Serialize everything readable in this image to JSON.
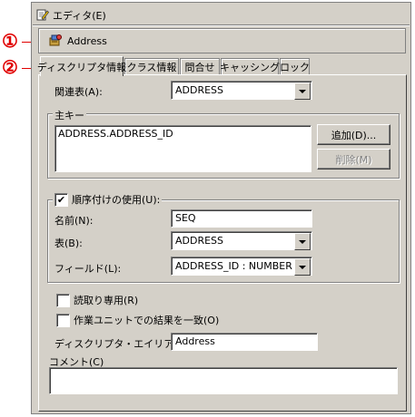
{
  "callouts": {
    "one": "①",
    "two": "②"
  },
  "editor": {
    "title": "エディタ(E)",
    "header_name": "Address",
    "icon": "pencil-edit-icon",
    "header_icon": "class-descriptor-icon"
  },
  "tabs": [
    {
      "label": "ディスクリプタ情報",
      "active": true
    },
    {
      "label": "クラス情報"
    },
    {
      "label": "問合せ"
    },
    {
      "label": "キャッシング"
    },
    {
      "label": "ロック"
    }
  ],
  "form": {
    "related_table_label": "関連表(A):",
    "related_table_value": "ADDRESS",
    "primary_key": {
      "group_label": "主キー",
      "items": [
        "ADDRESS.ADDRESS_ID"
      ],
      "add_button": "追加(D)...",
      "remove_button": "削除(M)"
    },
    "sequencing": {
      "checkbox_label": "順序付けの使用(U):",
      "checked": true,
      "name_label": "名前(N):",
      "name_value": "SEQ",
      "table_label": "表(B):",
      "table_value": "ADDRESS",
      "field_label": "フィールド(L):",
      "field_value": "ADDRESS_ID : NUMBER"
    },
    "read_only_label": "読取り専用(R)",
    "read_only_checked": false,
    "unit_of_work_label": "作業ユニットでの結果を一致(O)",
    "unit_of_work_checked": false,
    "alias_label": "ディスクリプタ・エイリアス(C):",
    "alias_value": "Address",
    "comment_label": "コメント(C)",
    "comment_value": ""
  }
}
